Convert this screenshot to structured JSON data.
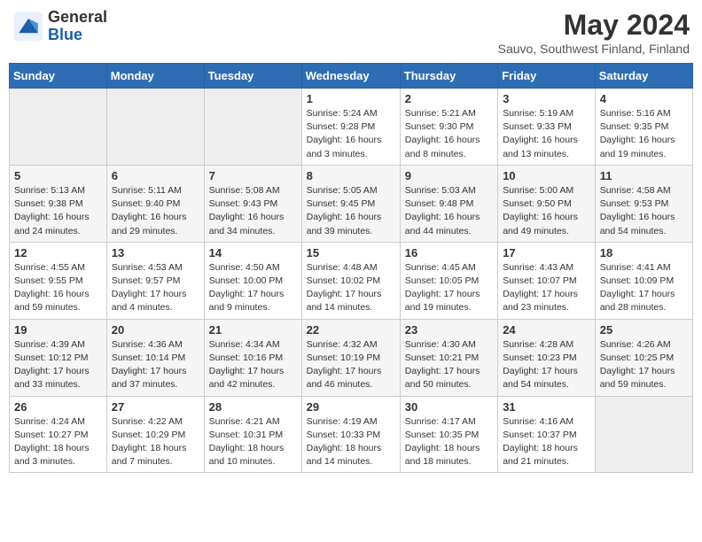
{
  "header": {
    "logo_general": "General",
    "logo_blue": "Blue",
    "month_title": "May 2024",
    "location": "Sauvo, Southwest Finland, Finland"
  },
  "weekdays": [
    "Sunday",
    "Monday",
    "Tuesday",
    "Wednesday",
    "Thursday",
    "Friday",
    "Saturday"
  ],
  "weeks": [
    [
      {
        "day": "",
        "info": ""
      },
      {
        "day": "",
        "info": ""
      },
      {
        "day": "",
        "info": ""
      },
      {
        "day": "1",
        "info": "Sunrise: 5:24 AM\nSunset: 9:28 PM\nDaylight: 16 hours\nand 3 minutes."
      },
      {
        "day": "2",
        "info": "Sunrise: 5:21 AM\nSunset: 9:30 PM\nDaylight: 16 hours\nand 8 minutes."
      },
      {
        "day": "3",
        "info": "Sunrise: 5:19 AM\nSunset: 9:33 PM\nDaylight: 16 hours\nand 13 minutes."
      },
      {
        "day": "4",
        "info": "Sunrise: 5:16 AM\nSunset: 9:35 PM\nDaylight: 16 hours\nand 19 minutes."
      }
    ],
    [
      {
        "day": "5",
        "info": "Sunrise: 5:13 AM\nSunset: 9:38 PM\nDaylight: 16 hours\nand 24 minutes."
      },
      {
        "day": "6",
        "info": "Sunrise: 5:11 AM\nSunset: 9:40 PM\nDaylight: 16 hours\nand 29 minutes."
      },
      {
        "day": "7",
        "info": "Sunrise: 5:08 AM\nSunset: 9:43 PM\nDaylight: 16 hours\nand 34 minutes."
      },
      {
        "day": "8",
        "info": "Sunrise: 5:05 AM\nSunset: 9:45 PM\nDaylight: 16 hours\nand 39 minutes."
      },
      {
        "day": "9",
        "info": "Sunrise: 5:03 AM\nSunset: 9:48 PM\nDaylight: 16 hours\nand 44 minutes."
      },
      {
        "day": "10",
        "info": "Sunrise: 5:00 AM\nSunset: 9:50 PM\nDaylight: 16 hours\nand 49 minutes."
      },
      {
        "day": "11",
        "info": "Sunrise: 4:58 AM\nSunset: 9:53 PM\nDaylight: 16 hours\nand 54 minutes."
      }
    ],
    [
      {
        "day": "12",
        "info": "Sunrise: 4:55 AM\nSunset: 9:55 PM\nDaylight: 16 hours\nand 59 minutes."
      },
      {
        "day": "13",
        "info": "Sunrise: 4:53 AM\nSunset: 9:57 PM\nDaylight: 17 hours\nand 4 minutes."
      },
      {
        "day": "14",
        "info": "Sunrise: 4:50 AM\nSunset: 10:00 PM\nDaylight: 17 hours\nand 9 minutes."
      },
      {
        "day": "15",
        "info": "Sunrise: 4:48 AM\nSunset: 10:02 PM\nDaylight: 17 hours\nand 14 minutes."
      },
      {
        "day": "16",
        "info": "Sunrise: 4:45 AM\nSunset: 10:05 PM\nDaylight: 17 hours\nand 19 minutes."
      },
      {
        "day": "17",
        "info": "Sunrise: 4:43 AM\nSunset: 10:07 PM\nDaylight: 17 hours\nand 23 minutes."
      },
      {
        "day": "18",
        "info": "Sunrise: 4:41 AM\nSunset: 10:09 PM\nDaylight: 17 hours\nand 28 minutes."
      }
    ],
    [
      {
        "day": "19",
        "info": "Sunrise: 4:39 AM\nSunset: 10:12 PM\nDaylight: 17 hours\nand 33 minutes."
      },
      {
        "day": "20",
        "info": "Sunrise: 4:36 AM\nSunset: 10:14 PM\nDaylight: 17 hours\nand 37 minutes."
      },
      {
        "day": "21",
        "info": "Sunrise: 4:34 AM\nSunset: 10:16 PM\nDaylight: 17 hours\nand 42 minutes."
      },
      {
        "day": "22",
        "info": "Sunrise: 4:32 AM\nSunset: 10:19 PM\nDaylight: 17 hours\nand 46 minutes."
      },
      {
        "day": "23",
        "info": "Sunrise: 4:30 AM\nSunset: 10:21 PM\nDaylight: 17 hours\nand 50 minutes."
      },
      {
        "day": "24",
        "info": "Sunrise: 4:28 AM\nSunset: 10:23 PM\nDaylight: 17 hours\nand 54 minutes."
      },
      {
        "day": "25",
        "info": "Sunrise: 4:26 AM\nSunset: 10:25 PM\nDaylight: 17 hours\nand 59 minutes."
      }
    ],
    [
      {
        "day": "26",
        "info": "Sunrise: 4:24 AM\nSunset: 10:27 PM\nDaylight: 18 hours\nand 3 minutes."
      },
      {
        "day": "27",
        "info": "Sunrise: 4:22 AM\nSunset: 10:29 PM\nDaylight: 18 hours\nand 7 minutes."
      },
      {
        "day": "28",
        "info": "Sunrise: 4:21 AM\nSunset: 10:31 PM\nDaylight: 18 hours\nand 10 minutes."
      },
      {
        "day": "29",
        "info": "Sunrise: 4:19 AM\nSunset: 10:33 PM\nDaylight: 18 hours\nand 14 minutes."
      },
      {
        "day": "30",
        "info": "Sunrise: 4:17 AM\nSunset: 10:35 PM\nDaylight: 18 hours\nand 18 minutes."
      },
      {
        "day": "31",
        "info": "Sunrise: 4:16 AM\nSunset: 10:37 PM\nDaylight: 18 hours\nand 21 minutes."
      },
      {
        "day": "",
        "info": ""
      }
    ]
  ]
}
